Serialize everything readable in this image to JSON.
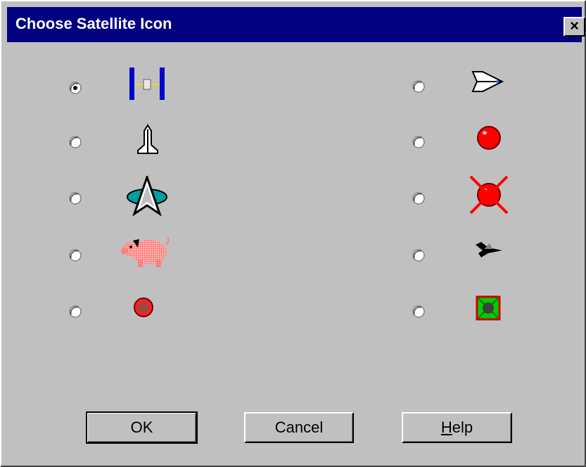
{
  "dialog": {
    "title": "Choose Satellite Icon",
    "close_label": "×",
    "selected": "space-station"
  },
  "options": [
    {
      "icon": "space-station-icon",
      "selected": true
    },
    {
      "icon": "space-shuttle-side-icon",
      "selected": false
    },
    {
      "icon": "shuttle-launch-icon",
      "selected": false
    },
    {
      "icon": "red-ball-icon",
      "selected": false
    },
    {
      "icon": "starfleet-delta-icon",
      "selected": false
    },
    {
      "icon": "red-ball-crossed-icon",
      "selected": false
    },
    {
      "icon": "pig-icon",
      "selected": false
    },
    {
      "icon": "jet-icon",
      "selected": false
    },
    {
      "icon": "target-ring-icon",
      "selected": false
    },
    {
      "icon": "boxed-target-icon",
      "selected": false
    }
  ],
  "buttons": {
    "ok_label": "OK",
    "cancel_label": "Cancel",
    "help_prefix": "H",
    "help_rest": "elp"
  },
  "colors": {
    "titlebar": "#000080",
    "face": "#c0c0c0",
    "red": "#ff0000",
    "blue": "#0000cc",
    "green": "#00cc00"
  }
}
